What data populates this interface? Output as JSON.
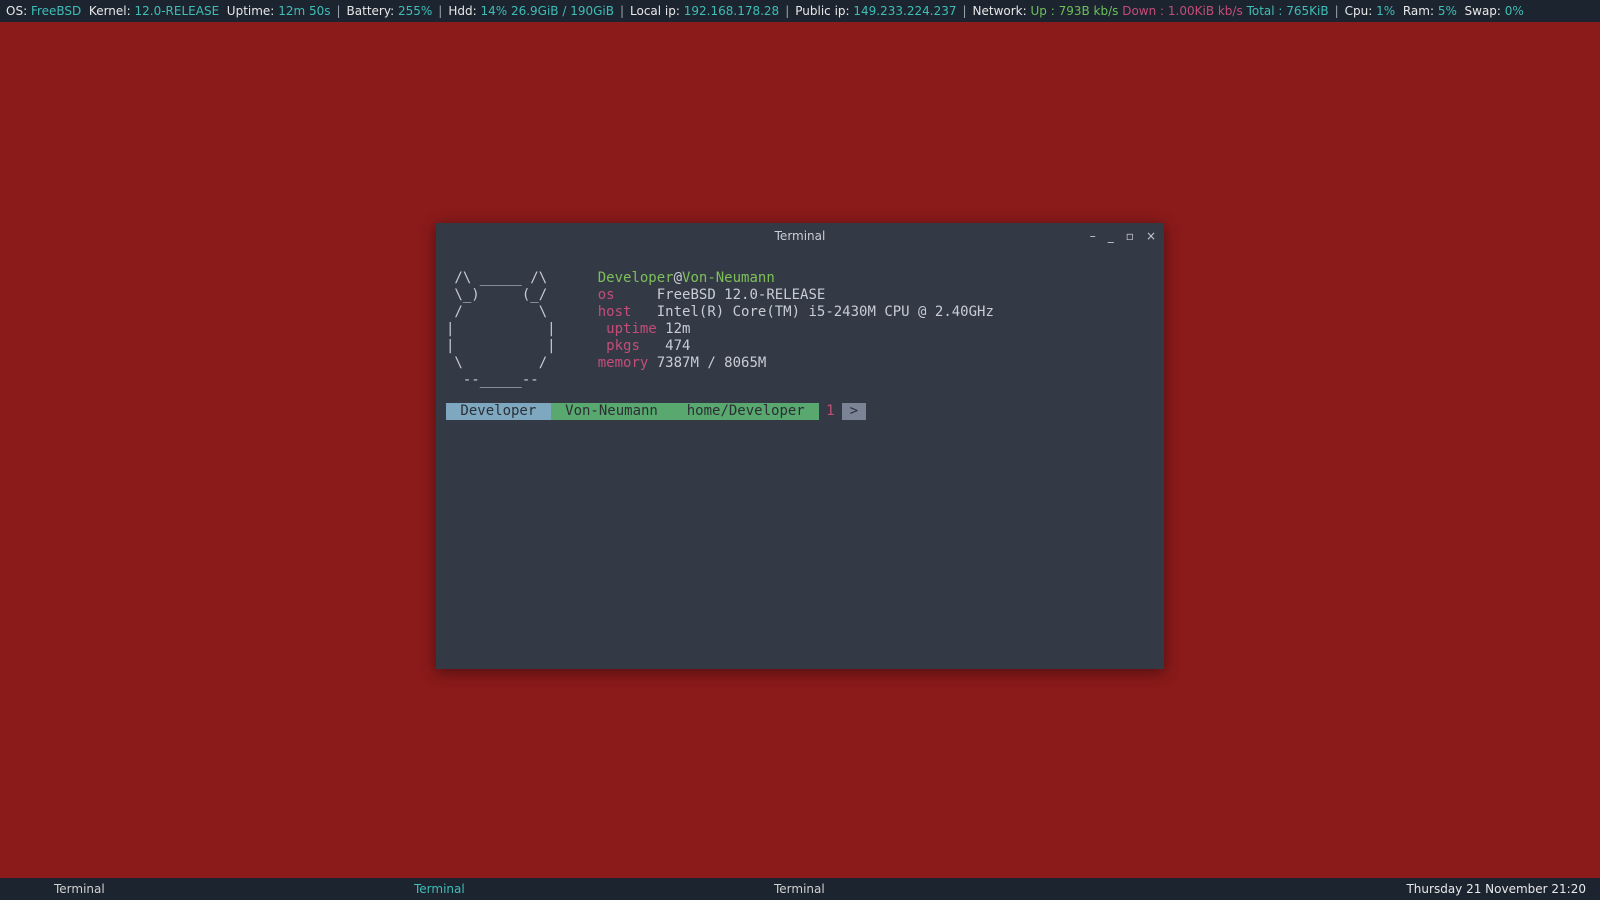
{
  "topbar": {
    "os_label": "OS:",
    "os_value": "FreeBSD",
    "kernel_label": "Kernel:",
    "kernel_value": "12.0-RELEASE",
    "uptime_label": "Uptime:",
    "uptime_value": "12m 50s",
    "battery_label": "Battery:",
    "battery_value": "255%",
    "hdd_label": "Hdd:",
    "hdd_value": "14% 26.9GiB / 190GiB",
    "localip_label": "Local ip:",
    "localip_value": "192.168.178.28",
    "publicip_label": "Public ip:",
    "publicip_value": "149.233.224.237",
    "network_label": "Network:",
    "net_up": "Up : 793B kb/s",
    "net_down": "Down : 1.00KiB kb/s",
    "net_total": "Total : 765KiB",
    "cpu_label": "Cpu:",
    "cpu_value": "1%",
    "ram_label": "Ram:",
    "ram_value": "5%",
    "swap_label": "Swap:",
    "swap_value": "0%",
    "sep": "|"
  },
  "taskbar": {
    "items": [
      "Terminal",
      "Terminal",
      "Terminal"
    ],
    "active_index": 1,
    "clock": "Thursday 21 November 21:20"
  },
  "terminal": {
    "title": "Terminal",
    "btn_shade": "–",
    "btn_min": "_",
    "btn_max": "▫",
    "btn_close": "×",
    "ascii": [
      " /\\ _____ /\\",
      " \\_)     (_/",
      " /         \\",
      "|           |",
      "|           |",
      " \\         /",
      "  --_____--"
    ],
    "header_user": "Developer",
    "header_at": "@",
    "header_host": "Von-Neumann",
    "rows": {
      "os_k": "os",
      "os_v": "FreeBSD 12.0-RELEASE",
      "host_k": "host",
      "host_v": "Intel(R) Core(TM) i5-2430M CPU @ 2.40GHz",
      "uptime_k": "uptime",
      "uptime_v": "12m",
      "pkgs_k": "pkgs",
      "pkgs_v": "474",
      "memory_k": "memory",
      "memory_v": "7387M / 8065M"
    },
    "prompt": {
      "user": " Developer ",
      "host": " Von-Neumann ",
      "path": " home/Developer ",
      "num": "1",
      "arrow": ">"
    }
  }
}
